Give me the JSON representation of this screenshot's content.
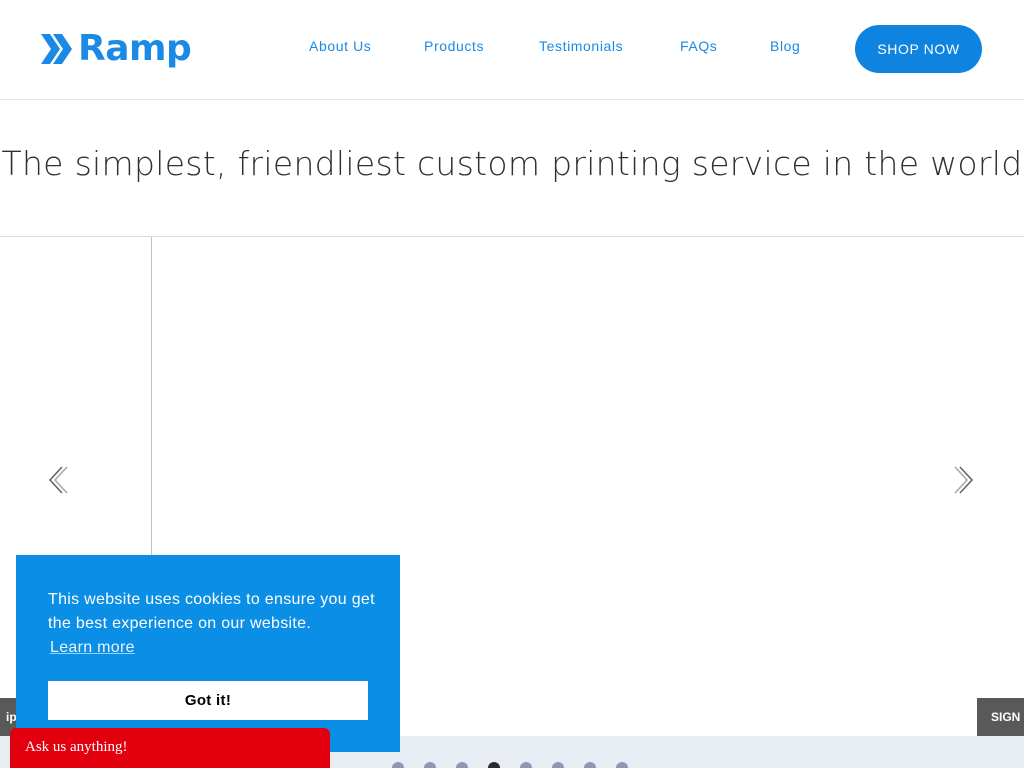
{
  "brand": {
    "name": "Ramp",
    "accent": "#1a8ae6",
    "button_color": "#0e84e0"
  },
  "nav": {
    "items": [
      {
        "label": "About Us"
      },
      {
        "label": "Products"
      },
      {
        "label": "Testimonials"
      },
      {
        "label": "FAQs"
      },
      {
        "label": "Blog"
      }
    ],
    "cta_label": "SHOP NOW"
  },
  "hero": {
    "title": "The simplest, friendliest custom printing service in the world"
  },
  "carousel": {
    "prev_icon": "chevron-left-icon",
    "next_icon": "chevron-right-icon",
    "left_tab_label": "ipp",
    "right_tab_label": "SIGN",
    "slide_count": 8,
    "active_slide": 4
  },
  "cookie_banner": {
    "message": "This website uses cookies to ensure you get the best experience on our website.",
    "learn_more": "Learn more",
    "accept_label": "Got it!",
    "color": "#0b8ee6"
  },
  "chat": {
    "label": "Ask us anything!",
    "color": "#e2000f"
  }
}
